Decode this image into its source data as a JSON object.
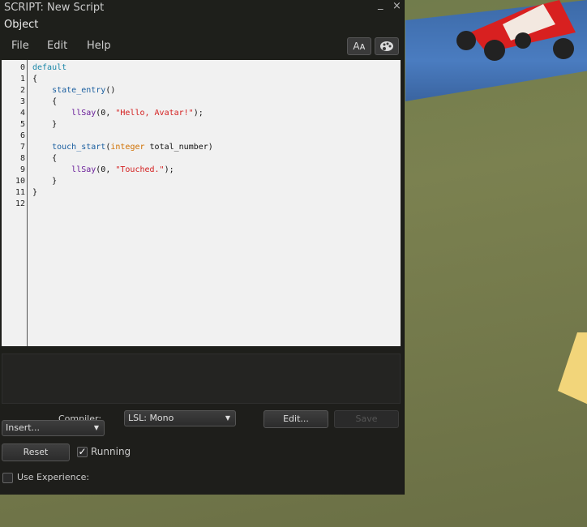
{
  "window": {
    "title": "SCRIPT: New Script",
    "object": "Object",
    "minimize": "_",
    "close": "×"
  },
  "menu": {
    "file": "File",
    "edit": "Edit",
    "help": "Help",
    "font_button": "Aᴀ",
    "palette_icon": "palette-icon"
  },
  "editor": {
    "line_numbers": [
      "0",
      "1",
      "2",
      "3",
      "4",
      "5",
      "6",
      "7",
      "8",
      "9",
      "10",
      "11",
      "12"
    ],
    "lines": [
      [
        {
          "t": "default",
          "c": "#1b87a8"
        }
      ],
      [
        {
          "t": "{",
          "c": "#111"
        }
      ],
      [
        {
          "t": "    ",
          "c": "#111"
        },
        {
          "t": "state_entry",
          "c": "#1b5fa0"
        },
        {
          "t": "()",
          "c": "#111"
        }
      ],
      [
        {
          "t": "    {",
          "c": "#111"
        }
      ],
      [
        {
          "t": "        ",
          "c": "#111"
        },
        {
          "t": "llSay",
          "c": "#6a1f9a"
        },
        {
          "t": "(0, ",
          "c": "#111"
        },
        {
          "t": "\"Hello, Avatar!\"",
          "c": "#d42020"
        },
        {
          "t": ");",
          "c": "#111"
        }
      ],
      [
        {
          "t": "    }",
          "c": "#111"
        }
      ],
      [
        {
          "t": "",
          "c": "#111"
        }
      ],
      [
        {
          "t": "    ",
          "c": "#111"
        },
        {
          "t": "touch_start",
          "c": "#1b5fa0"
        },
        {
          "t": "(",
          "c": "#111"
        },
        {
          "t": "integer",
          "c": "#d07000"
        },
        {
          "t": " total_number)",
          "c": "#111"
        }
      ],
      [
        {
          "t": "    {",
          "c": "#111"
        }
      ],
      [
        {
          "t": "        ",
          "c": "#111"
        },
        {
          "t": "llSay",
          "c": "#6a1f9a"
        },
        {
          "t": "(0, ",
          "c": "#111"
        },
        {
          "t": "\"Touched.\"",
          "c": "#d42020"
        },
        {
          "t": ");",
          "c": "#111"
        }
      ],
      [
        {
          "t": "    }",
          "c": "#111"
        }
      ],
      [
        {
          "t": "}",
          "c": "#111"
        }
      ],
      [
        {
          "t": "",
          "c": "#111"
        }
      ]
    ]
  },
  "controls": {
    "compiler_label": "Compiler:",
    "compiler_value": "LSL: Mono",
    "insert": "Insert...",
    "edit": "Edit...",
    "save": "Save",
    "reset": "Reset",
    "running": "Running",
    "running_checked": true,
    "use_experience": "Use Experience:",
    "use_experience_checked": false,
    "dropdown_arrow": "▼"
  }
}
